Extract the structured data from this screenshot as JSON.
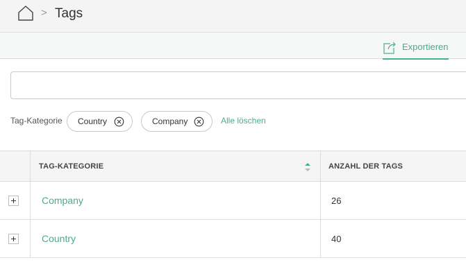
{
  "breadcrumb": {
    "separator": ">",
    "title": "Tags",
    "home_icon": "home-icon"
  },
  "toolbar": {
    "export_label": "Exportieren",
    "export_icon": "export-icon"
  },
  "search": {
    "value": "",
    "placeholder": ""
  },
  "filters": {
    "label": "Tag-Kategorie",
    "chips": [
      {
        "label": "Country"
      },
      {
        "label": "Company"
      }
    ],
    "clear_all": "Alle löschen"
  },
  "table": {
    "columns": [
      "TAG-KATEGORIE",
      "ANZAHL DER TAGS"
    ],
    "rows": [
      {
        "category": "Company",
        "count": "26"
      },
      {
        "category": "Country",
        "count": "40"
      }
    ]
  },
  "colors": {
    "accent": "#4aab93",
    "border": "#dcdcdc",
    "header_bg": "#f4f4f4"
  }
}
